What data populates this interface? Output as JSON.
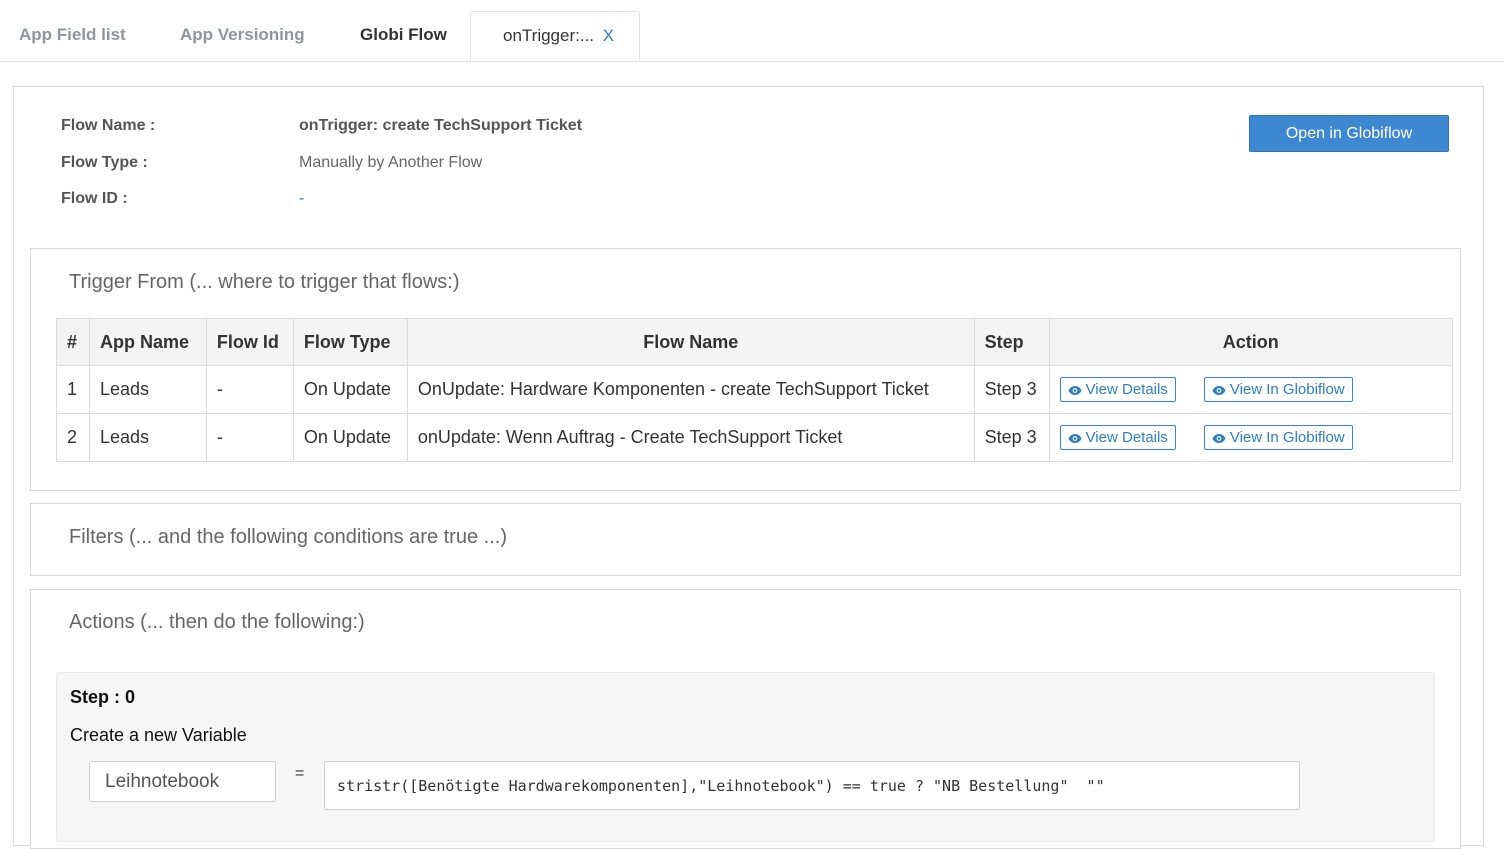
{
  "tabs": [
    {
      "label": "App Field list"
    },
    {
      "label": "App Versioning"
    },
    {
      "label": "Globi Flow"
    },
    {
      "label": "onTrigger:...",
      "close": "X"
    }
  ],
  "flow_info": {
    "name_label": "Flow Name :",
    "name_value": "onTrigger: create TechSupport Ticket",
    "type_label": "Flow Type :",
    "type_value": "Manually by Another Flow",
    "id_label": "Flow ID :",
    "id_value": "-",
    "open_button": "Open in Globiflow"
  },
  "trigger_section": {
    "title": "Trigger From (... where to trigger that flows:)",
    "columns": [
      "#",
      "App Name",
      "Flow Id",
      "Flow Type",
      "Flow Name",
      "Step",
      "Action"
    ],
    "rows": [
      {
        "num": "1",
        "app": "Leads",
        "flow_id": "-",
        "flow_type": "On Update",
        "flow_name": "OnUpdate: Hardware Komponenten - create TechSupport Ticket",
        "step": "Step 3"
      },
      {
        "num": "2",
        "app": "Leads",
        "flow_id": "-",
        "flow_type": "On Update",
        "flow_name": "onUpdate: Wenn Auftrag - Create TechSupport Ticket",
        "step": "Step 3"
      }
    ],
    "view_details_label": "View Details",
    "view_globiflow_label": "View In Globiflow"
  },
  "filters_section": {
    "title": "Filters (... and the following conditions are true ...)"
  },
  "actions_section": {
    "title": "Actions (... then do the following:)",
    "step_title": "Step : 0",
    "step_desc": "Create a new Variable",
    "variable_name": "Leihnotebook",
    "equals": "=",
    "expression": "stristr([Benötigte Hardwarekomponenten],\"Leihnotebook\") == true ? \"NB Bestellung\"  \"\""
  },
  "colors": {
    "accent": "#3d88d0",
    "link": "#2f7ec5",
    "border": "#dcdcdc",
    "muted_tab": "#8f969c"
  }
}
